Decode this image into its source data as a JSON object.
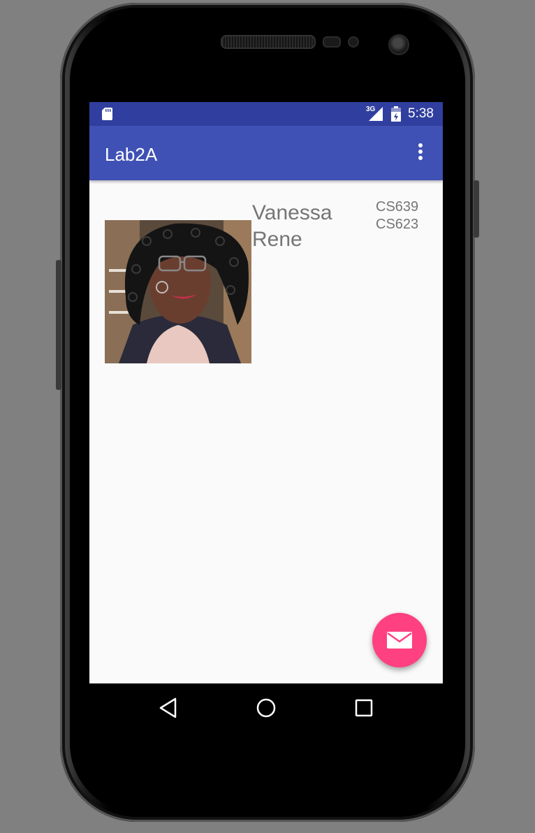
{
  "status_bar": {
    "network": "3G",
    "time": "5:38",
    "icons": [
      "sd-card-icon",
      "signal-icon",
      "battery-icon"
    ]
  },
  "toolbar": {
    "title": "Lab2A",
    "menu_icon": "overflow-menu-icon"
  },
  "profile": {
    "name": "Vanessa Rene",
    "courses": [
      "CS639",
      "CS623"
    ]
  },
  "fab": {
    "icon": "email-icon"
  },
  "nav": {
    "icons": [
      "back-icon",
      "home-icon",
      "recents-icon"
    ]
  },
  "colors": {
    "status_bar": "#303f9f",
    "primary": "#3f51b5",
    "accent": "#ff4081",
    "text_secondary": "#757575",
    "background": "#fafafa"
  }
}
